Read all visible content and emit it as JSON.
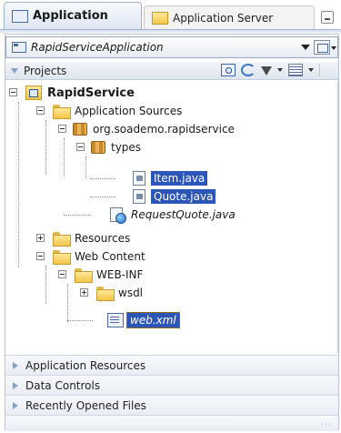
{
  "tabs": {
    "active": "Application",
    "inactive": "Application Server"
  },
  "app_selector": {
    "value": "RapidServiceApplication"
  },
  "projects": {
    "label": "Projects"
  },
  "tree": {
    "project": "RapidService",
    "app_sources": "Application Sources",
    "package": "org.soademo.rapidservice",
    "types": "types",
    "item": "Item.java",
    "quote": "Quote.java",
    "request_quote": "RequestQuote.java",
    "resources": "Resources",
    "web_content": "Web Content",
    "web_inf": "WEB-INF",
    "wsdl": "wsdl",
    "web_xml": "web.xml"
  },
  "accordions": {
    "application_resources": "Application Resources",
    "data_controls": "Data Controls",
    "recent_files": "Recently Opened Files"
  }
}
